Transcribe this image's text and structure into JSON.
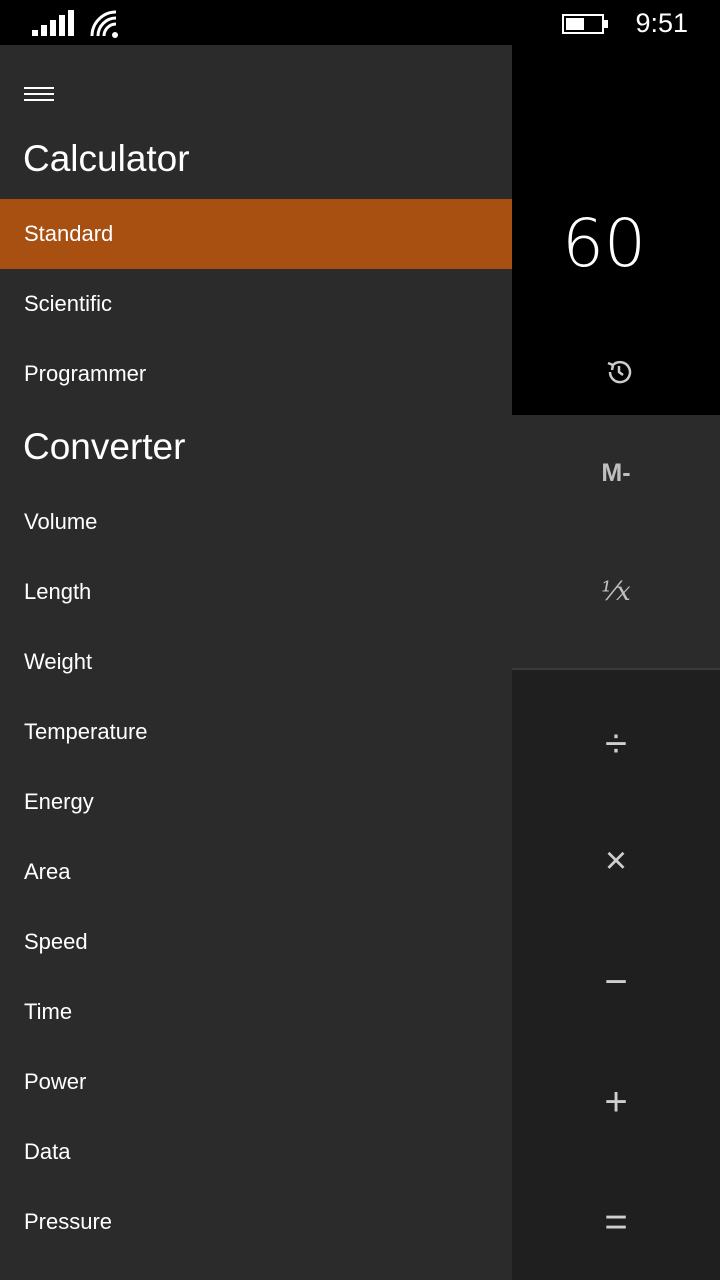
{
  "status_bar": {
    "time": "9:51",
    "icons": [
      "signal-strength-icon",
      "wifi-icon",
      "battery-icon"
    ]
  },
  "calculator": {
    "display_value": "60",
    "history_icon": "history-icon",
    "memory_keys": [
      "M-"
    ],
    "function_keys": [
      "¹⁄x"
    ],
    "operator_keys": [
      "÷",
      "×",
      "−",
      "+",
      "="
    ]
  },
  "nav": {
    "menu_icon": "hamburger-menu-icon",
    "calculator_title": "Calculator",
    "calculator_items": [
      {
        "label": "Standard",
        "selected": true
      },
      {
        "label": "Scientific",
        "selected": false
      },
      {
        "label": "Programmer",
        "selected": false
      }
    ],
    "converter_title": "Converter",
    "converter_items": [
      {
        "label": "Volume"
      },
      {
        "label": "Length"
      },
      {
        "label": "Weight"
      },
      {
        "label": "Temperature"
      },
      {
        "label": "Energy"
      },
      {
        "label": "Area"
      },
      {
        "label": "Speed"
      },
      {
        "label": "Time"
      },
      {
        "label": "Power"
      },
      {
        "label": "Data"
      },
      {
        "label": "Pressure"
      }
    ]
  },
  "colors": {
    "accent": "#a84f12",
    "pane_background": "#2b2b2b",
    "display_background": "#000000"
  }
}
